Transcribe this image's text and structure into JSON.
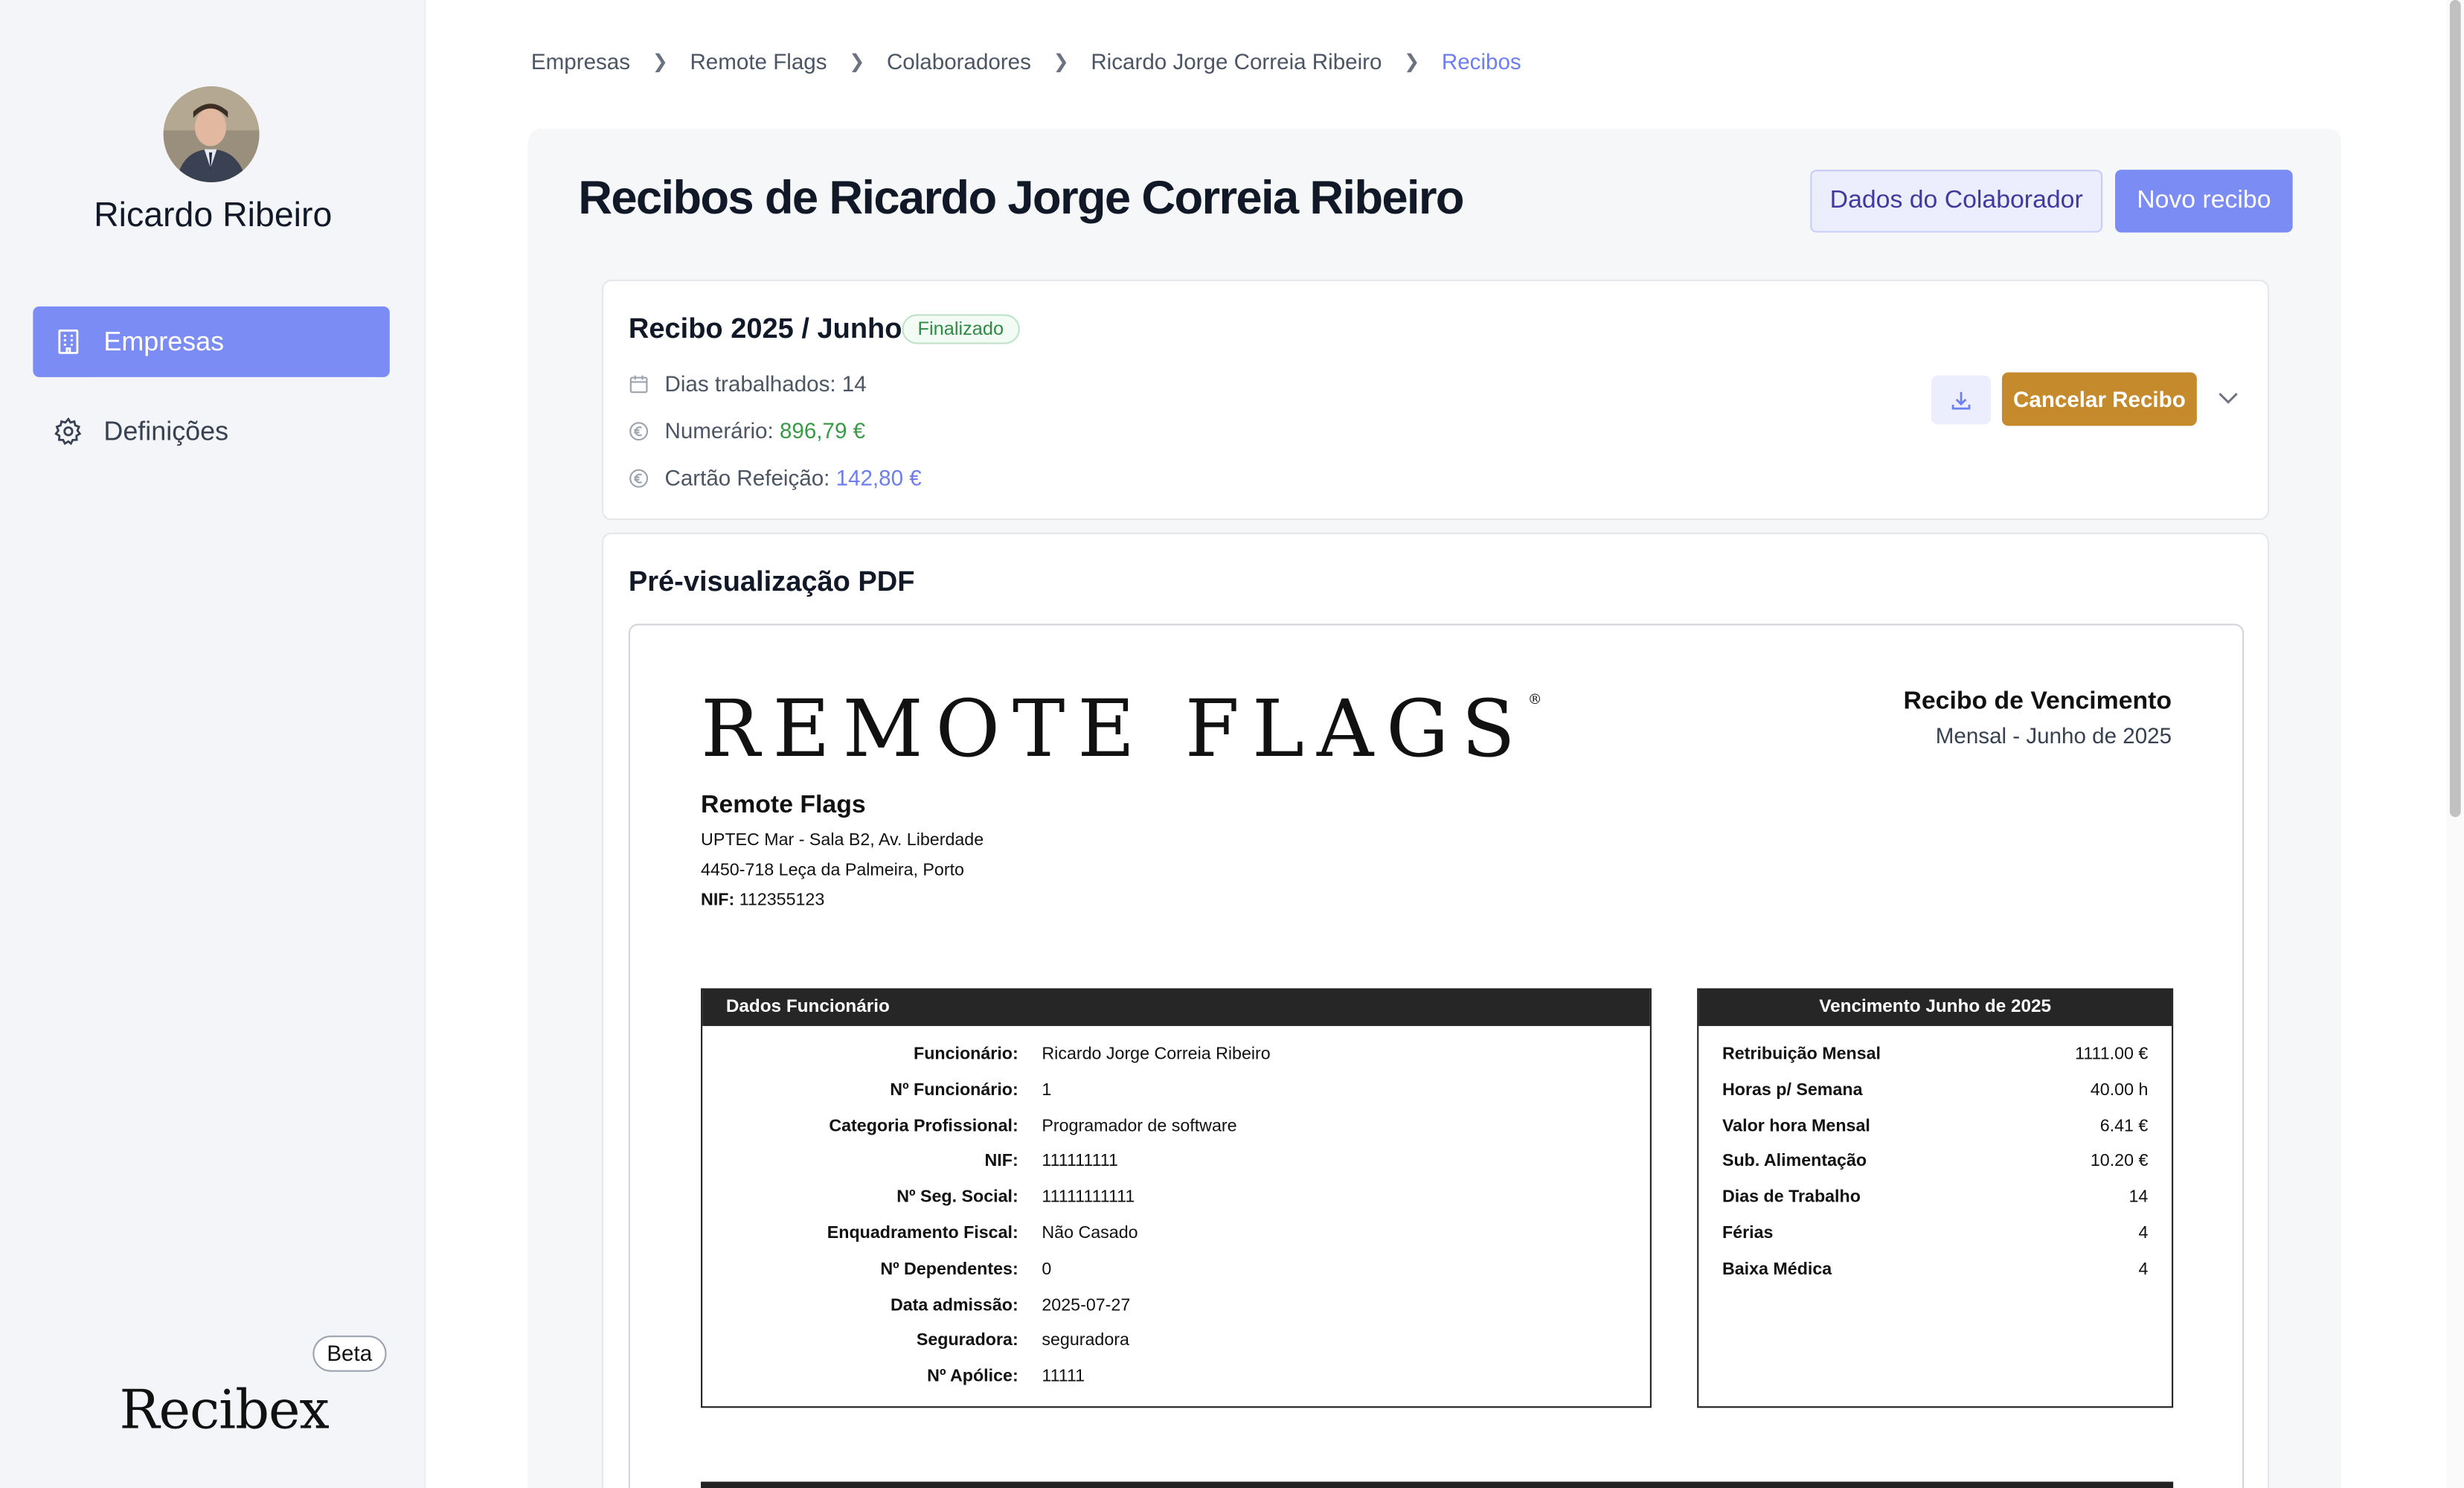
{
  "user": {
    "name": "Ricardo Ribeiro"
  },
  "sidebar": {
    "items": [
      {
        "label": "Empresas",
        "icon": "building-icon",
        "active": true
      },
      {
        "label": "Definições",
        "icon": "gear-icon",
        "active": false
      }
    ],
    "beta": "Beta",
    "logo": "Recibex"
  },
  "breadcrumb": [
    "Empresas",
    "Remote Flags",
    "Colaboradores",
    "Ricardo Jorge Correia Ribeiro",
    "Recibos"
  ],
  "header": {
    "title": "Recibos de Ricardo Jorge Correia Ribeiro",
    "secondary_button": "Dados do Colaborador",
    "primary_button": "Novo recibo"
  },
  "receipt": {
    "title": "Recibo 2025 / Junho",
    "status": "Finalizado",
    "days_label": "Dias trabalhados:",
    "days": "14",
    "cash_label": "Numerário:",
    "cash": "896,79 €",
    "meal_label": "Cartão Refeição:",
    "meal": "142,80 €",
    "cancel_button": "Cancelar Recibo"
  },
  "preview": {
    "title": "Pré-visualização PDF",
    "brand": "REMOTE FLAGS",
    "brand_mark": "®",
    "doc_title": "Recibo de Vencimento",
    "doc_subtitle": "Mensal - Junho de 2025",
    "company": {
      "name": "Remote Flags",
      "address1": "UPTEC Mar - Sala B2, Av. Liberdade",
      "address2": "4450-718 Leça da Palmeira, Porto",
      "nif_label": "NIF:",
      "nif": "112355123"
    },
    "employee_table": {
      "title": "Dados Funcionário",
      "rows": [
        {
          "label": "Funcionário:",
          "value": "Ricardo Jorge Correia Ribeiro"
        },
        {
          "label": "Nº Funcionário:",
          "value": "1"
        },
        {
          "label": "Categoria Profissional:",
          "value": "Programador de software"
        },
        {
          "label": "NIF:",
          "value": "111111111"
        },
        {
          "label": "Nº Seg. Social:",
          "value": "11111111111"
        },
        {
          "label": "Enquadramento Fiscal:",
          "value": "Não Casado"
        },
        {
          "label": "Nº Dependentes:",
          "value": "0"
        },
        {
          "label": "Data admissão:",
          "value": "2025-07-27"
        },
        {
          "label": "Seguradora:",
          "value": "seguradora"
        },
        {
          "label": "Nº Apólice:",
          "value": "11111"
        }
      ]
    },
    "salary_table": {
      "title": "Vencimento Junho de 2025",
      "rows": [
        {
          "label": "Retribuição Mensal",
          "value": "1111.00 €"
        },
        {
          "label": "Horas p/ Semana",
          "value": "40.00 h"
        },
        {
          "label": "Valor hora Mensal",
          "value": "6.41 €"
        },
        {
          "label": "Sub. Alimentação",
          "value": "10.20 €"
        },
        {
          "label": "Dias de Trabalho",
          "value": "14"
        },
        {
          "label": "Férias",
          "value": "4"
        },
        {
          "label": "Baixa Médica",
          "value": "4"
        }
      ]
    }
  },
  "colors": {
    "accent": "#7c8cf5",
    "cancel": "#c48a2c",
    "success": "#3a9a48"
  }
}
